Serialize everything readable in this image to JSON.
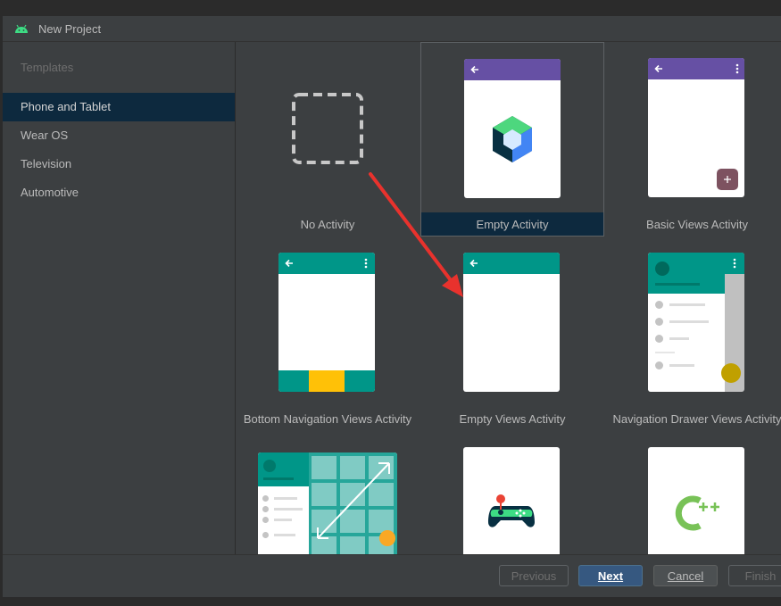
{
  "window": {
    "title": "New Project"
  },
  "sidebar": {
    "header": "Templates",
    "items": [
      {
        "label": "Phone and Tablet",
        "selected": true
      },
      {
        "label": "Wear OS",
        "selected": false
      },
      {
        "label": "Television",
        "selected": false
      },
      {
        "label": "Automotive",
        "selected": false
      }
    ]
  },
  "templates": [
    {
      "label": "No Activity"
    },
    {
      "label": "Empty Activity",
      "selected": true
    },
    {
      "label": "Basic Views Activity"
    },
    {
      "label": "Bottom Navigation Views Activity"
    },
    {
      "label": "Empty Views Activity"
    },
    {
      "label": "Navigation Drawer Views Activity"
    }
  ],
  "footer": {
    "previous_label": "Previous",
    "next_label": "Next",
    "cancel_label": "Cancel",
    "finish_label": "Finish"
  },
  "colors": {
    "purple_bar": "#6650a4",
    "teal_bar": "#009688",
    "selection": "#0d293e",
    "annotation_arrow": "#e8322d"
  }
}
